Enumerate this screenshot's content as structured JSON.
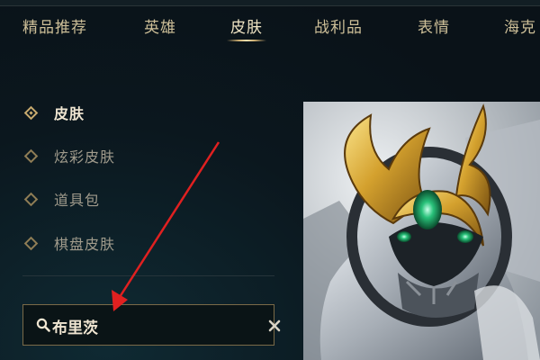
{
  "tabs": [
    {
      "label": "精品推荐",
      "active": false
    },
    {
      "label": "英雄",
      "active": false
    },
    {
      "label": "皮肤",
      "active": true
    },
    {
      "label": "战利品",
      "active": false
    },
    {
      "label": "表情",
      "active": false
    },
    {
      "label": "海克",
      "active": false
    }
  ],
  "sidebar": {
    "items": [
      {
        "label": "皮肤",
        "active": true
      },
      {
        "label": "炫彩皮肤",
        "active": false
      },
      {
        "label": "道具包",
        "active": false
      },
      {
        "label": "棋盘皮肤",
        "active": false
      }
    ]
  },
  "search": {
    "value": "布里茨",
    "icon": "search-icon",
    "clear_icon": "close-icon"
  },
  "preview": {
    "subject": "champion-skin-artwork"
  },
  "colors": {
    "accent_gold": "#c8aa6e",
    "text_light": "#f0e6d2",
    "background": "#0a1218",
    "annotation_arrow": "#e02020"
  }
}
